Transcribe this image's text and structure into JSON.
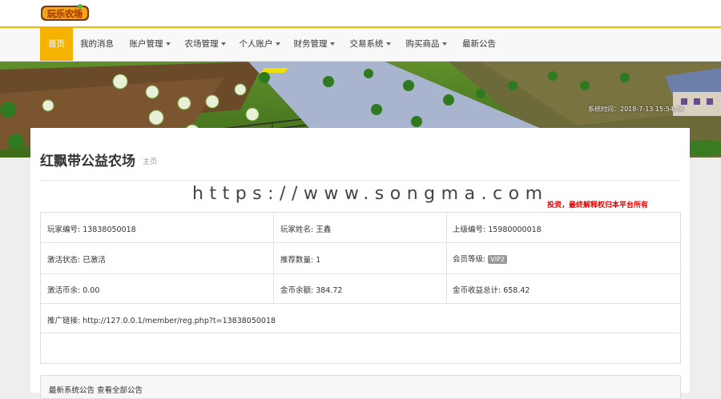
{
  "logo": {
    "text": "玩乐农场"
  },
  "nav": {
    "items": [
      {
        "label": "首页",
        "dropdown": false
      },
      {
        "label": "我的消息",
        "dropdown": false
      },
      {
        "label": "账户管理",
        "dropdown": true
      },
      {
        "label": "农场管理",
        "dropdown": true
      },
      {
        "label": "个人账户",
        "dropdown": true
      },
      {
        "label": "财务管理",
        "dropdown": true
      },
      {
        "label": "交易系统",
        "dropdown": true
      },
      {
        "label": "购买商品",
        "dropdown": true
      },
      {
        "label": "最新公告",
        "dropdown": false
      }
    ],
    "active_index": 0
  },
  "banner": {
    "system_time": "系统时间：2018-7-13 15:54:36"
  },
  "page": {
    "title": "红飘带公益农场",
    "subtitle": "主页",
    "watermark": "https://www.songma.com",
    "notice": "投资，最终解释权归本平台所有"
  },
  "info": {
    "player_id": "玩家编号: 13838050018",
    "player_name": "玩家姓名: 王鑫",
    "parent_id": "上级编号: 15980000018",
    "activation_status": "激活状态: 已激活",
    "referral_count": "推荐数量: 1",
    "member_level_label": "会员等级:",
    "member_level": "VIP2",
    "activation_balance": "激活币余: 0.00",
    "gold_balance": "金币余额: 384.72",
    "gold_income_total": "金币收益总计: 658.42",
    "referral_link": "推广链接: http://127.0.0.1/member/reg.php?t=13838050018"
  },
  "announcement": {
    "title": "最新系统公告",
    "view_all": "查看全部公告"
  },
  "colors": {
    "accent": "#f5b300",
    "notice": "#e00000"
  }
}
